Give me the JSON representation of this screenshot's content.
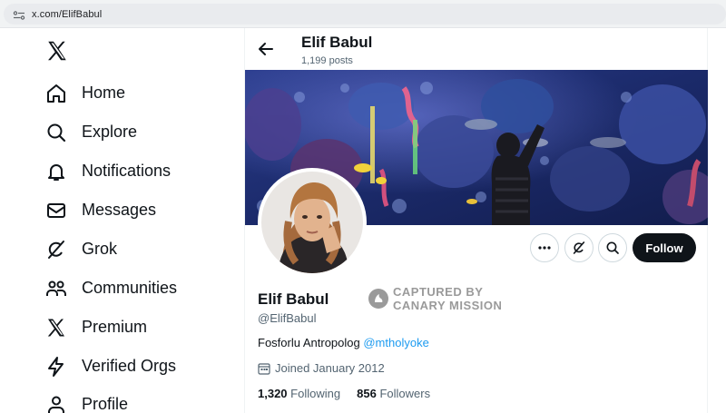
{
  "browser": {
    "url": "x.com/ElifBabul"
  },
  "sidebar": {
    "items": [
      {
        "label": "Home",
        "icon": "home-icon"
      },
      {
        "label": "Explore",
        "icon": "search-icon"
      },
      {
        "label": "Notifications",
        "icon": "bell-icon"
      },
      {
        "label": "Messages",
        "icon": "envelope-icon"
      },
      {
        "label": "Grok",
        "icon": "grok-icon"
      },
      {
        "label": "Communities",
        "icon": "people-icon"
      },
      {
        "label": "Premium",
        "icon": "x-logo-icon"
      },
      {
        "label": "Verified Orgs",
        "icon": "lightning-icon"
      },
      {
        "label": "Profile",
        "icon": "person-icon"
      }
    ]
  },
  "header": {
    "name": "Elif Babul",
    "posts": "1,199 posts"
  },
  "profile": {
    "name": "Elif Babul",
    "handle": "@ElifBabul",
    "bio_text": "Fosforlu Antropolog ",
    "bio_mention": "@mtholyoke",
    "joined": "Joined January 2012",
    "following_count": "1,320",
    "following_label": "Following",
    "followers_count": "856",
    "followers_label": "Followers"
  },
  "actions": {
    "follow_label": "Follow"
  },
  "watermark": {
    "line1": "CAPTURED BY",
    "line2": "CANARY MISSION"
  },
  "colors": {
    "accent_link": "#1d9bf0",
    "follow_bg": "#0f1419",
    "secondary_text": "#536471"
  }
}
